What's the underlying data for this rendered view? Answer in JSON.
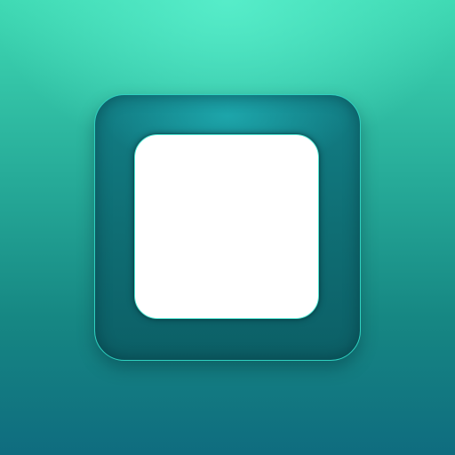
{
  "icon": {
    "name": "rounded-square-stop-icon",
    "colors": {
      "background_top": "#4ff0cf",
      "background_bottom": "#0f6c7f",
      "frame": "#0f6e74",
      "frame_edge": "#2fd1c0",
      "inner": "#ffffff"
    }
  }
}
